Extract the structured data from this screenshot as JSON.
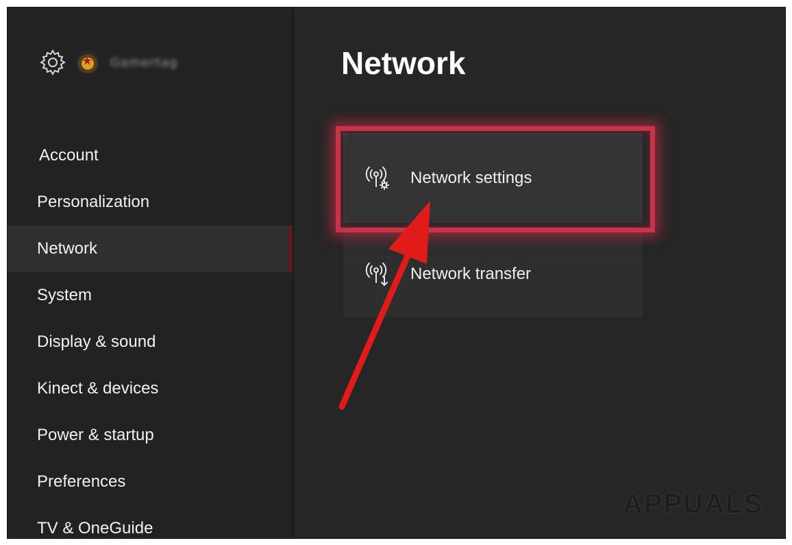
{
  "header": {
    "page_title": "Network"
  },
  "profile": {
    "gamertag": "Gamertag"
  },
  "sidebar": {
    "items": [
      {
        "label": "Account"
      },
      {
        "label": "Personalization"
      },
      {
        "label": "Network",
        "active": true
      },
      {
        "label": "System"
      },
      {
        "label": "Display & sound"
      },
      {
        "label": "Kinect & devices"
      },
      {
        "label": "Power & startup"
      },
      {
        "label": "Preferences"
      },
      {
        "label": "TV & OneGuide"
      }
    ]
  },
  "main": {
    "tiles": [
      {
        "label": "Network settings",
        "icon": "network-settings-icon",
        "highlighted": true
      },
      {
        "label": "Network transfer",
        "icon": "network-transfer-icon"
      }
    ]
  },
  "annotation": {
    "highlight_color": "#c7344a",
    "arrow_color": "#e11a1a"
  },
  "watermark": {
    "text": "APPUALS"
  }
}
